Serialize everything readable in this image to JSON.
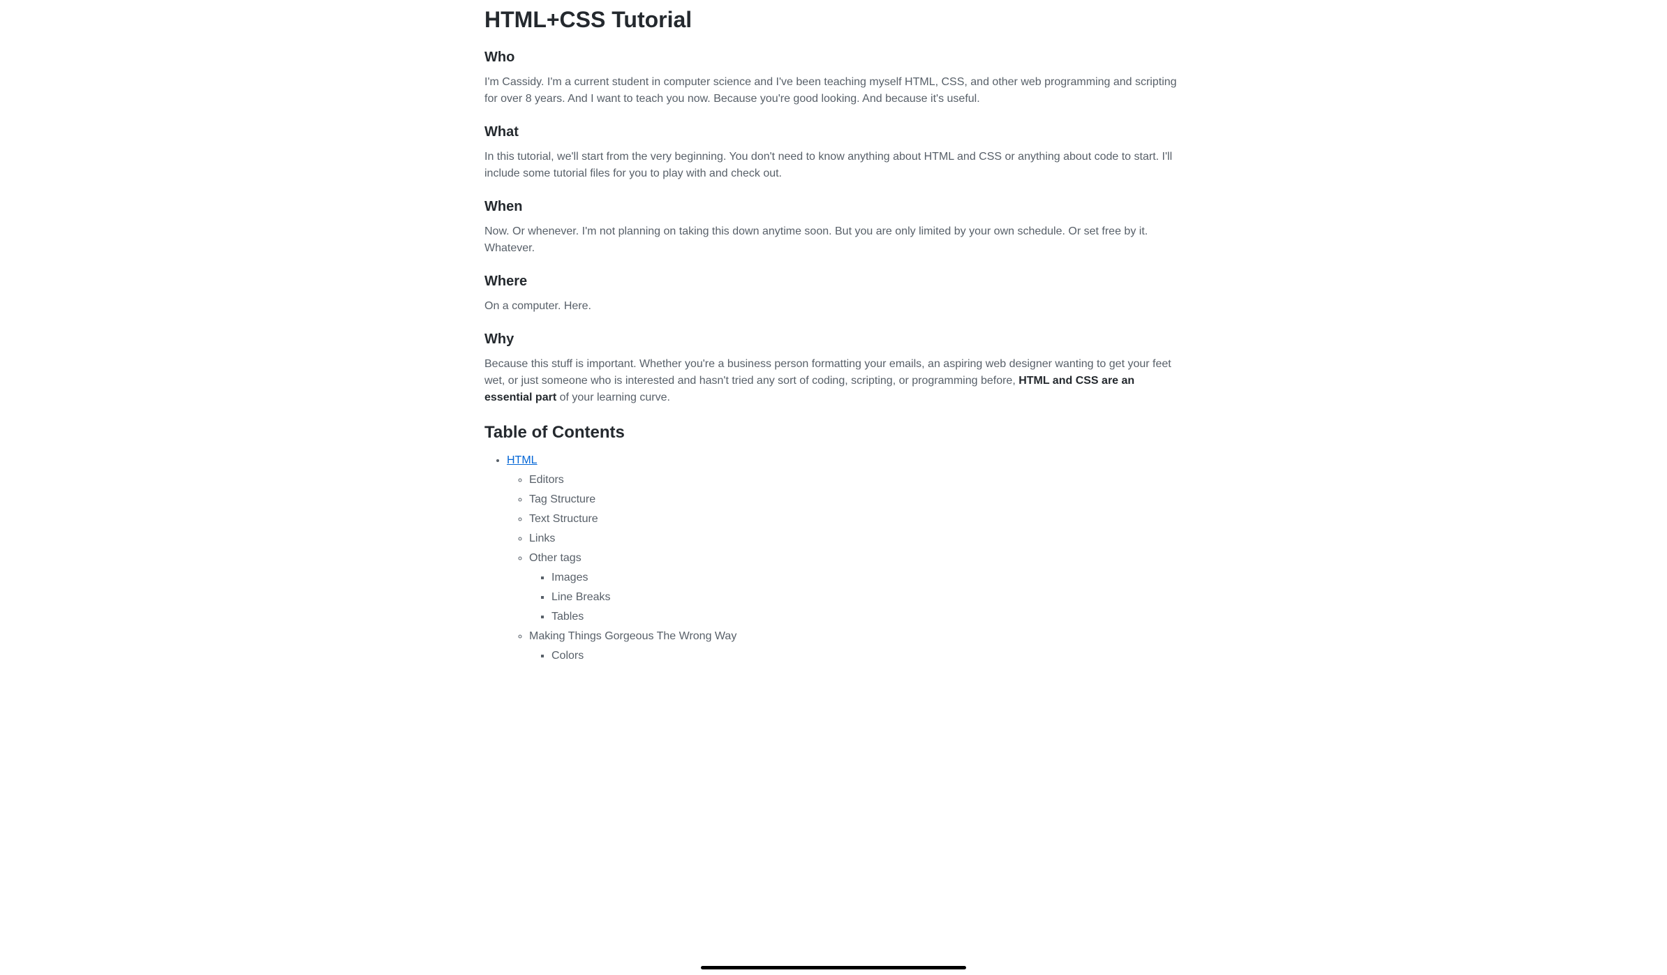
{
  "title": "HTML+CSS Tutorial",
  "sections": {
    "who": {
      "heading": "Who",
      "body": "I'm Cassidy. I'm a current student in computer science and I've been teaching myself HTML, CSS, and other web programming and scripting for over 8 years. And I want to teach you now. Because you're good looking. And because it's useful."
    },
    "what": {
      "heading": "What",
      "body": "In this tutorial, we'll start from the very beginning. You don't need to know anything about HTML and CSS or anything about code to start. I'll include some tutorial files for you to play with and check out."
    },
    "when": {
      "heading": "When",
      "body": "Now. Or whenever. I'm not planning on taking this down anytime soon. But you are only limited by your own schedule. Or set free by it. Whatever."
    },
    "where": {
      "heading": "Where",
      "body": "On a computer. Here."
    },
    "why": {
      "heading": "Why",
      "body_prefix": "Because this stuff is important. Whether you're a business person formatting your emails, an aspiring web designer wanting to get your feet wet, or just someone who is interested and hasn't tried any sort of coding, scripting, or programming before, ",
      "body_strong": "HTML and CSS are an essential part",
      "body_suffix": " of your learning curve."
    }
  },
  "toc": {
    "heading": "Table of Contents",
    "html_link": "HTML",
    "items": {
      "editors": "Editors",
      "tag_structure": "Tag Structure",
      "text_structure": "Text Structure",
      "links": "Links",
      "other_tags": "Other tags",
      "images": "Images",
      "line_breaks": "Line Breaks",
      "tables": "Tables",
      "making_gorgeous": "Making Things Gorgeous The Wrong Way",
      "colors": "Colors"
    }
  }
}
